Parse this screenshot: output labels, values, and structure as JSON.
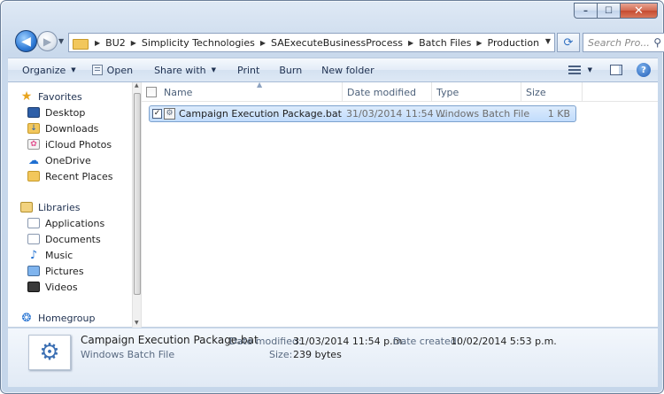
{
  "window": {
    "controls": {
      "minimize": "–",
      "maximize": "☐",
      "close": "✕"
    }
  },
  "navigation": {
    "back_glyph": "◀",
    "forward_glyph": "▶",
    "recent_glyph": "▼",
    "breadcrumbs": [
      "BU2",
      "Simplicity Technologies",
      "SAExecuteBusinessProcess",
      "Batch Files",
      "Production"
    ],
    "crumb_separator": "▶",
    "address_dropdown_glyph": "▼",
    "refresh_glyph": "⟳",
    "search_placeholder": "Search Pro...",
    "search_icon_glyph": "⚲"
  },
  "toolbar": {
    "organize": "Organize",
    "open": "Open",
    "share_with": "Share with",
    "print": "Print",
    "burn": "Burn",
    "new_folder": "New folder",
    "caret": "▼",
    "help": "?"
  },
  "sidebar": {
    "favorites": {
      "label": "Favorites",
      "items": [
        "Desktop",
        "Downloads",
        "iCloud Photos",
        "OneDrive",
        "Recent Places"
      ]
    },
    "libraries": {
      "label": "Libraries",
      "items": [
        "Applications",
        "Documents",
        "Music",
        "Pictures",
        "Videos"
      ]
    },
    "homegroup": {
      "label": "Homegroup"
    },
    "icons": {
      "favorites": "★",
      "downloads": "↓",
      "icloud": "✿",
      "onedrive": "☁",
      "music": "♪",
      "homegroup": "❂"
    }
  },
  "file_list": {
    "columns": {
      "name": "Name",
      "date_modified": "Date modified",
      "type": "Type",
      "size": "Size",
      "sort_glyph": "▲"
    },
    "rows": [
      {
        "name": "Campaign Execution Package.bat",
        "date_modified": "31/03/2014 11:54 ...",
        "type": "Windows Batch File",
        "size": "1 KB",
        "checked": "✓",
        "icon_glyph": "⚙"
      }
    ]
  },
  "details": {
    "file_name": "Campaign Execution Package.bat",
    "file_type": "Windows Batch File",
    "date_modified_label": "Date modified:",
    "date_modified_value": "31/03/2014 11:54 p.m.",
    "date_created_label": "Date created:",
    "date_created_value": "10/02/2014 5:53 p.m.",
    "size_label": "Size:",
    "size_value": "239 bytes",
    "thumb_glyph": "⚙"
  }
}
